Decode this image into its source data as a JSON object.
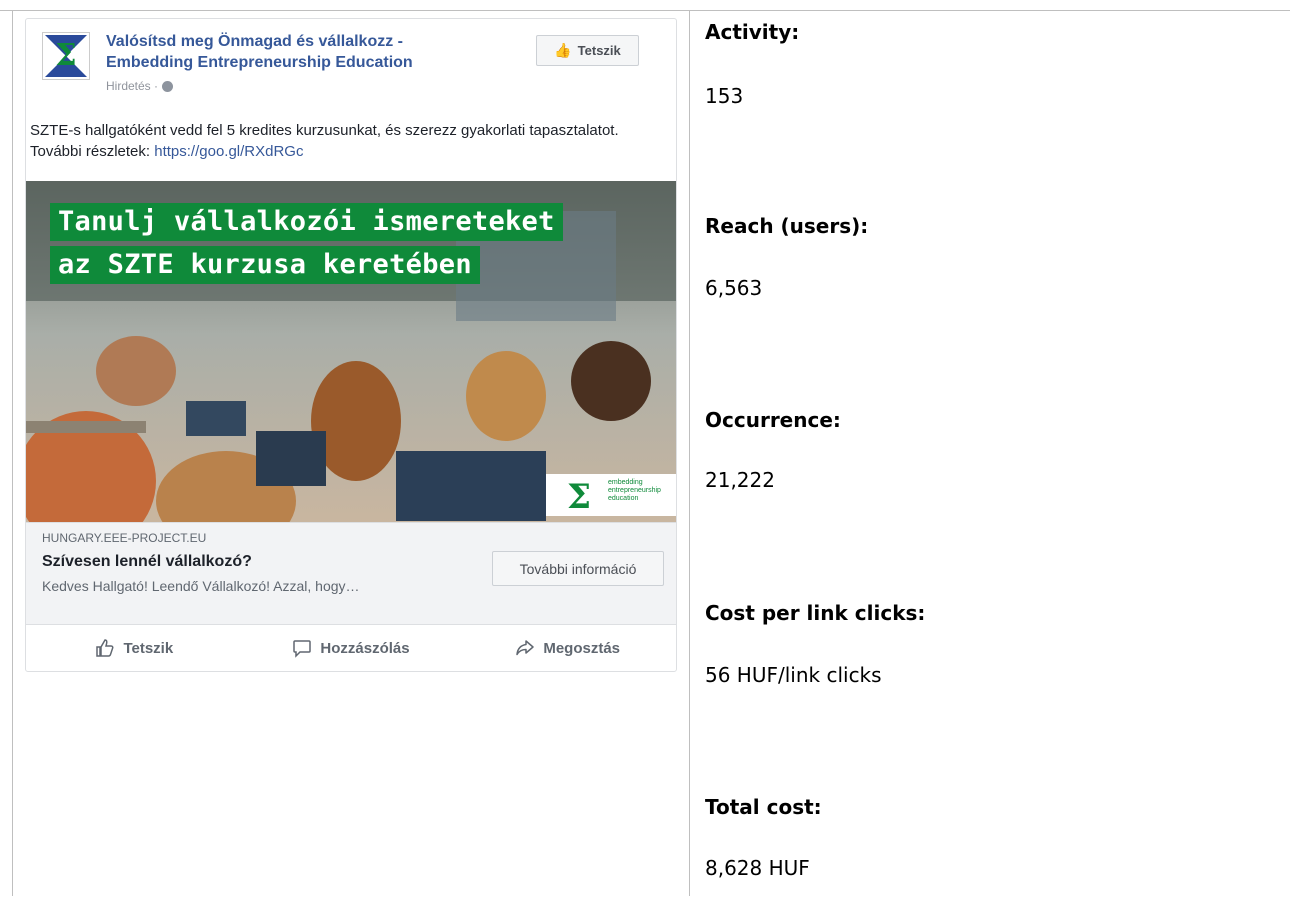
{
  "ad": {
    "page_name_line1": "Valósítsd meg Önmagad és vállalkozz -",
    "page_name_line2": "Embedding Entrepreneurship Education",
    "sponsored": "Hirdetés ·",
    "like_button": "Tetszik",
    "post_text": "SZTE-s hallgatóként vedd fel 5 kredites kurzusunkat, és szerezz gyakorlati tapasztalatot. További részletek: ",
    "post_link": "https://goo.gl/RXdRGc",
    "image": {
      "banner_line1": "Tanulj vállalkozói ismereteket",
      "banner_line2": "az SZTE kurzusa keretében",
      "logo_text": "embedding entrepreneurship education"
    },
    "link_domain": "HUNGARY.EEE-PROJECT.EU",
    "link_headline": "Szívesen lennél vállalkozó?",
    "link_description": "Kedves Hallgató! Leendő Vállalkozó!  Azzal, hogy…",
    "cta": "További információ",
    "actions": {
      "like": "Tetszik",
      "comment": "Hozzászólás",
      "share": "Megosztás"
    }
  },
  "stats": {
    "activity_label": "Activity:",
    "activity_value": "153",
    "reach_label": "Reach (users):",
    "reach_value": "6,563",
    "occurrence_label": "Occurrence:",
    "occurrence_value": "21,222",
    "cpc_label": "Cost per link clicks:",
    "cpc_value": "56 HUF/link clicks",
    "total_label": "Total cost:",
    "total_value": "8,628 HUF"
  }
}
